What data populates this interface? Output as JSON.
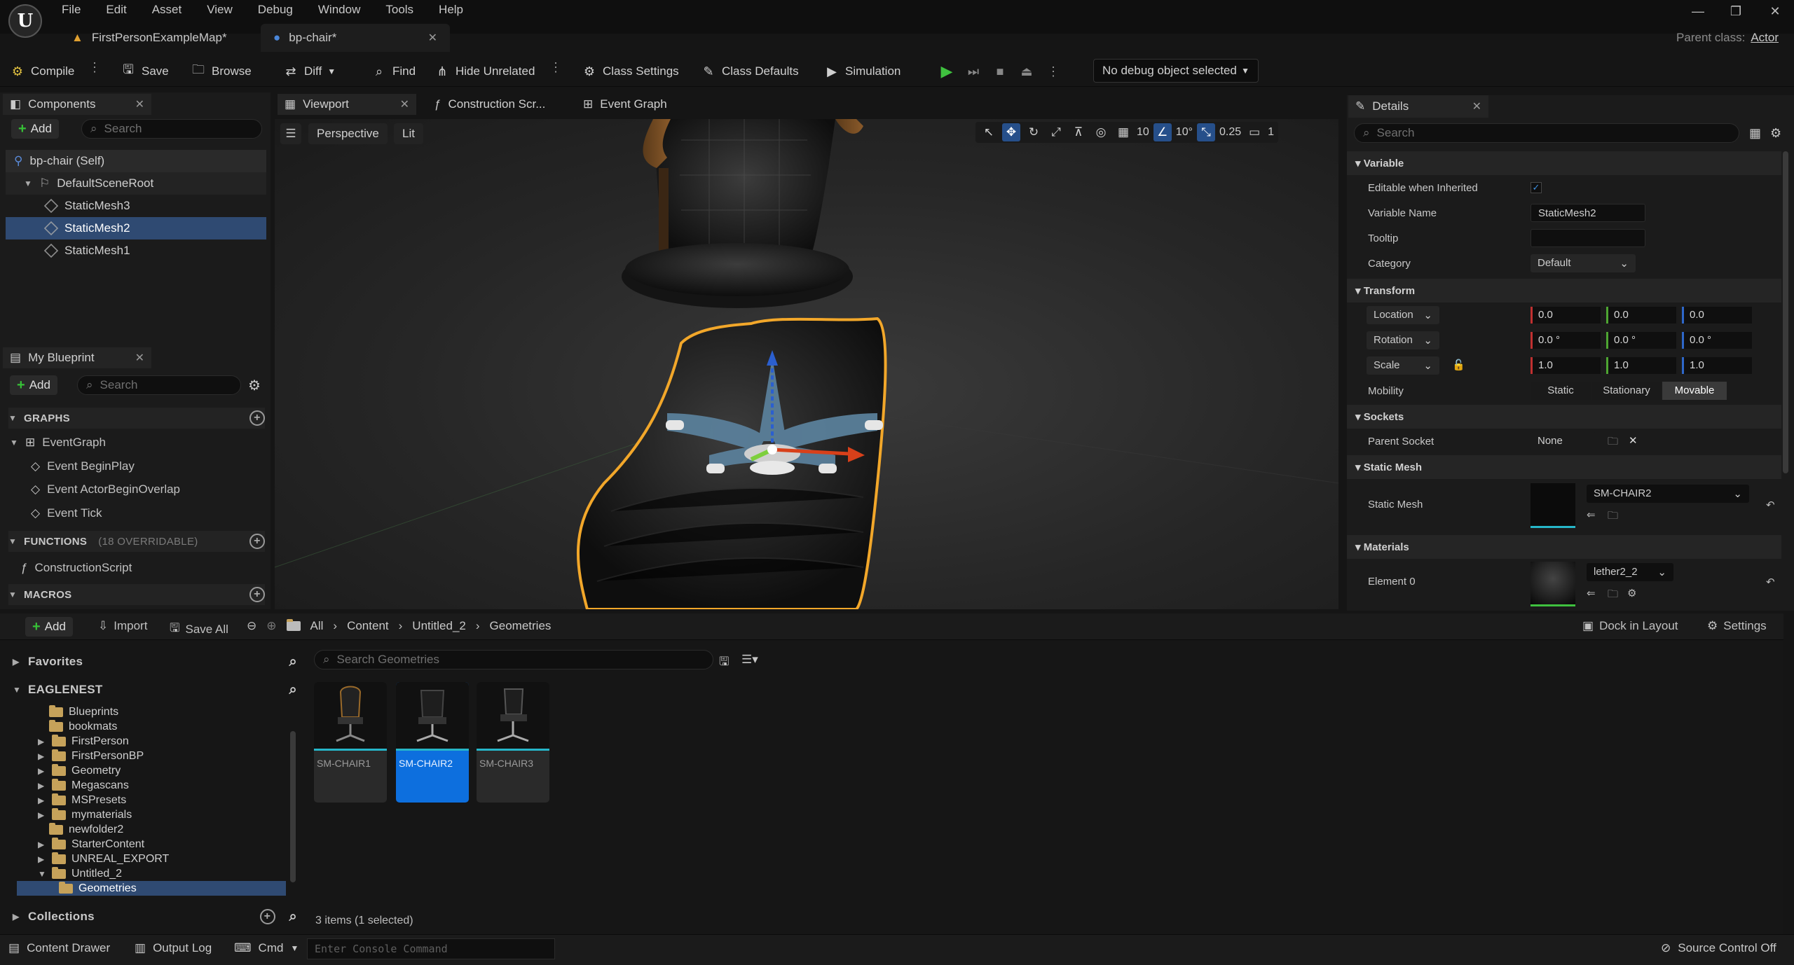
{
  "menu": [
    "File",
    "Edit",
    "Asset",
    "View",
    "Debug",
    "Window",
    "Tools",
    "Help"
  ],
  "tabs": [
    {
      "label": "FirstPersonExampleMap*"
    },
    {
      "label": "bp-chair*"
    }
  ],
  "parent_class": {
    "label": "Parent class:",
    "value": "Actor"
  },
  "toolbar": {
    "compile": "Compile",
    "save": "Save",
    "browse": "Browse",
    "diff": "Diff",
    "find": "Find",
    "hide_unrelated": "Hide Unrelated",
    "class_settings": "Class Settings",
    "class_defaults": "Class Defaults",
    "simulation": "Simulation",
    "debug_select": "No debug object selected"
  },
  "components": {
    "tab": "Components",
    "add": "Add",
    "search_placeholder": "Search",
    "items": [
      "bp-chair (Self)",
      "DefaultSceneRoot",
      "StaticMesh3",
      "StaticMesh2",
      "StaticMesh1"
    ]
  },
  "my_blueprint": {
    "tab": "My Blueprint",
    "add": "Add",
    "search_placeholder": "Search",
    "graphs": "GRAPHS",
    "event_graph": "EventGraph",
    "events": [
      "Event BeginPlay",
      "Event ActorBeginOverlap",
      "Event Tick"
    ],
    "functions": "FUNCTIONS",
    "functions_note": "(18 OVERRIDABLE)",
    "construction_script": "ConstructionScript",
    "macros": "MACROS"
  },
  "editor_tabs": [
    "Viewport",
    "Construction Scr...",
    "Event Graph"
  ],
  "viewport": {
    "perspective": "Perspective",
    "lit": "Lit",
    "grid_snap": "10",
    "rot_snap": "10°",
    "scale_snap": "0.25",
    "cam_speed": "1"
  },
  "details": {
    "tab": "Details",
    "search_placeholder": "Search",
    "sections": {
      "variable": "Variable",
      "transform": "Transform",
      "sockets": "Sockets",
      "static_mesh": "Static Mesh",
      "materials": "Materials"
    },
    "editable_label": "Editable when Inherited",
    "variable_name_label": "Variable Name",
    "variable_name": "StaticMesh2",
    "tooltip_label": "Tooltip",
    "tooltip_value": "",
    "category_label": "Category",
    "category": "Default",
    "location": "Location",
    "rotation": "Rotation",
    "scale": "Scale",
    "loc": [
      "0.0",
      "0.0",
      "0.0"
    ],
    "rot": [
      "0.0 °",
      "0.0 °",
      "0.0 °"
    ],
    "scl": [
      "1.0",
      "1.0",
      "1.0"
    ],
    "mobility_label": "Mobility",
    "mobility": [
      "Static",
      "Stationary",
      "Movable"
    ],
    "parent_socket_label": "Parent Socket",
    "parent_socket": "None",
    "static_mesh_label": "Static Mesh",
    "static_mesh": "SM-CHAIR2",
    "element0_label": "Element 0",
    "element0": "lether2_2"
  },
  "content_browser": {
    "add": "Add",
    "import": "Import",
    "save_all": "Save All",
    "crumbs": [
      "All",
      "Content",
      "Untitled_2",
      "Geometries"
    ],
    "dock": "Dock in Layout",
    "settings": "Settings",
    "favorites": "Favorites",
    "root": "EAGLENEST",
    "folders": [
      "Blueprints",
      "bookmats",
      "FirstPerson",
      "FirstPersonBP",
      "Geometry",
      "Megascans",
      "MSPresets",
      "mymaterials",
      "newfolder2",
      "StarterContent",
      "UNREAL_EXPORT",
      "Untitled_2",
      "Geometries"
    ],
    "collections": "Collections",
    "search_placeholder": "Search Geometries",
    "assets": [
      "SM-CHAIR1",
      "SM-CHAIR2",
      "SM-CHAIR3"
    ],
    "count": "3 items (1 selected)"
  },
  "statusbar": {
    "content_drawer": "Content Drawer",
    "output_log": "Output Log",
    "cmd": "Cmd",
    "console_placeholder": "Enter Console Command",
    "source_control": "Source Control Off"
  }
}
